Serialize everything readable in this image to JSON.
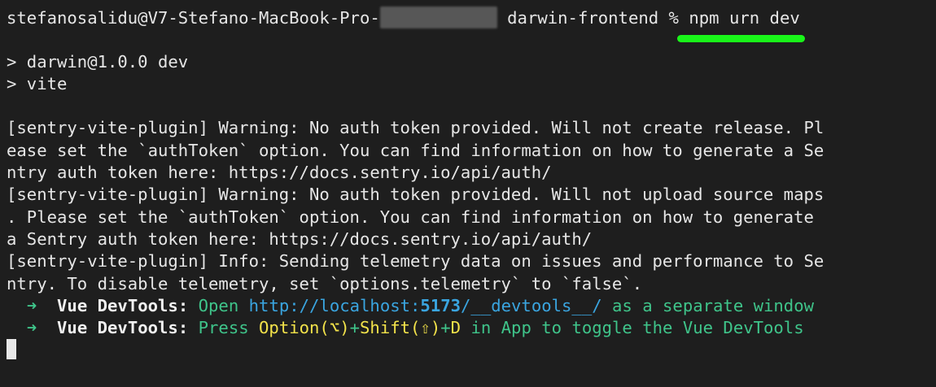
{
  "prompt": {
    "user_host": "stefanosalidu@V7-Stefano-MacBook-Pro-",
    "dir": "darwin-frontend",
    "symbol": "%",
    "command": "npm urn dev"
  },
  "npm_output": [
    "> darwin@1.0.0 dev",
    "> vite"
  ],
  "sentry_lines": [
    "[sentry-vite-plugin] Warning: No auth token provided. Will not create release. Pl",
    "ease set the `authToken` option. You can find information on how to generate a Se",
    "ntry auth token here: https://docs.sentry.io/api/auth/",
    "[sentry-vite-plugin] Warning: No auth token provided. Will not upload source maps",
    ". Please set the `authToken` option. You can find information on how to generate",
    "a Sentry auth token here: https://docs.sentry.io/api/auth/",
    "[sentry-vite-plugin] Info: Sending telemetry data on issues and performance to Se",
    "ntry. To disable telemetry, set `options.telemetry` to `false`."
  ],
  "devtools": {
    "arrow": "➜",
    "label": "Vue DevTools:",
    "line1": {
      "open": "Open",
      "url_prefix": "http://localhost:",
      "port": "5173",
      "url_suffix": "/__devtools__/",
      "tail": "as a separate window"
    },
    "line2": {
      "press": "Press",
      "keys_a": "Option(⌥)",
      "plus1": "+",
      "keys_b": "Shift(⇧)",
      "plus2": "+",
      "keys_c": "D",
      "tail": "in App to toggle the Vue DevTools"
    }
  },
  "colors": {
    "background": "#1e1e1e",
    "highlight_underline": "#19f519",
    "green_text": "#3fc48a",
    "url_blue": "#3aa5e0",
    "key_yellow": "#f2e24a"
  }
}
